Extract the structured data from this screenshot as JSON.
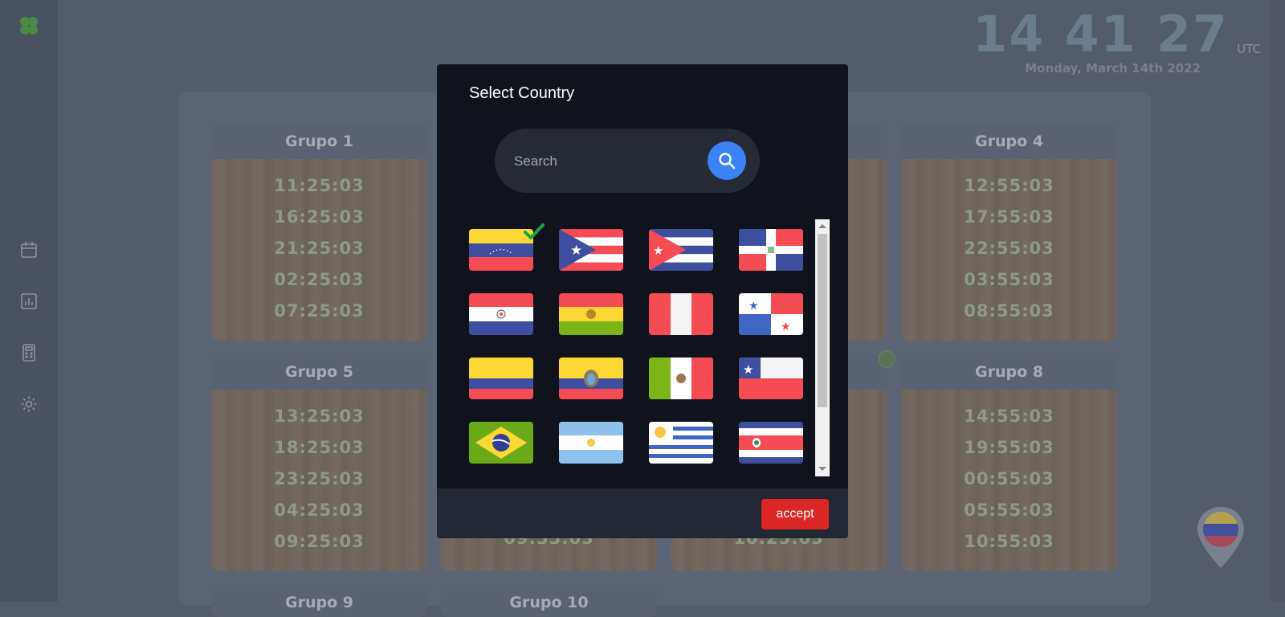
{
  "clock": {
    "hours": "14",
    "minutes": "41",
    "seconds": "27",
    "zone": "UTC",
    "date": "Monday, March 14th 2022"
  },
  "groups": [
    {
      "title": "Grupo 1",
      "times": [
        "11:25:03",
        "16:25:03",
        "21:25:03",
        "02:25:03",
        "07:25:03"
      ]
    },
    {
      "title": "Grupo 4",
      "times": [
        "12:55:03",
        "17:55:03",
        "22:55:03",
        "03:55:03",
        "08:55:03"
      ]
    },
    {
      "title": "Grupo 5",
      "times": [
        "13:25:03",
        "18:25:03",
        "23:25:03",
        "04:25:03",
        "09:25:03"
      ]
    },
    {
      "title": "Grupo 8",
      "times": [
        "14:55:03",
        "19:55:03",
        "00:55:03",
        "05:55:03",
        "10:55:03"
      ]
    }
  ],
  "partial_times": {
    "g6_last": "09:55:03",
    "g7_last": "10:25:03"
  },
  "bottom_groups": [
    "Grupo 9",
    "Grupo 10"
  ],
  "modal": {
    "title": "Select Country",
    "search_placeholder": "Search",
    "accept_label": "accept",
    "selected": "venezuela",
    "flags": [
      "venezuela",
      "puerto-rico",
      "cuba",
      "dominican-republic",
      "paraguay",
      "bolivia",
      "peru",
      "panama",
      "colombia",
      "ecuador",
      "mexico",
      "chile",
      "brazil",
      "argentina",
      "uruguay",
      "costa-rica"
    ]
  },
  "icons": [
    "clover-icon",
    "calendar-icon",
    "chart-icon",
    "calculator-icon",
    "gear-icon",
    "search-icon",
    "check-icon",
    "location-pin-icon"
  ]
}
